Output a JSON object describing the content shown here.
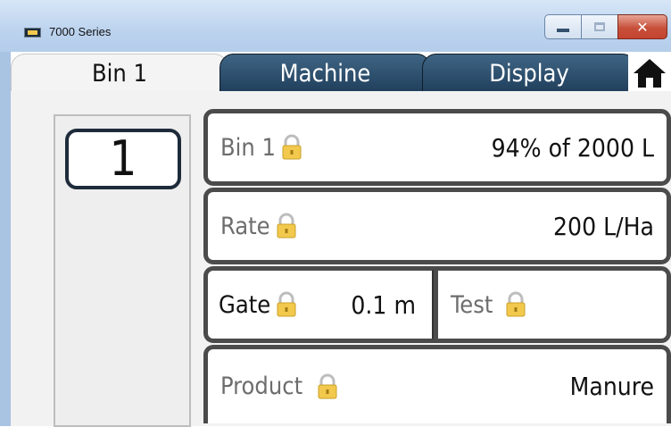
{
  "window": {
    "title": "7000 Series"
  },
  "tabs": [
    {
      "label": "Bin 1"
    },
    {
      "label": "Machine"
    },
    {
      "label": "Display"
    }
  ],
  "bin_number": "1",
  "fields": {
    "bin": {
      "label": "Bin 1",
      "value": "94% of 2000 L"
    },
    "rate": {
      "label": "Rate",
      "value": "200 L/Ha"
    },
    "gate": {
      "label": "Gate",
      "value": "0.1 m"
    },
    "test": {
      "label": "Test",
      "value": ""
    },
    "product": {
      "label": "Product",
      "value": "Manure"
    }
  },
  "icons": {
    "app": "app-icon",
    "home": "home-icon",
    "lock": "lock-icon",
    "minimize": "minimize-icon",
    "maximize": "maximize-icon",
    "close": "close-icon"
  },
  "colors": {
    "tab_dark": "#203f5c",
    "panel_border": "#4b4b4b",
    "lock": "#f2c94c",
    "close": "#c7503b"
  }
}
